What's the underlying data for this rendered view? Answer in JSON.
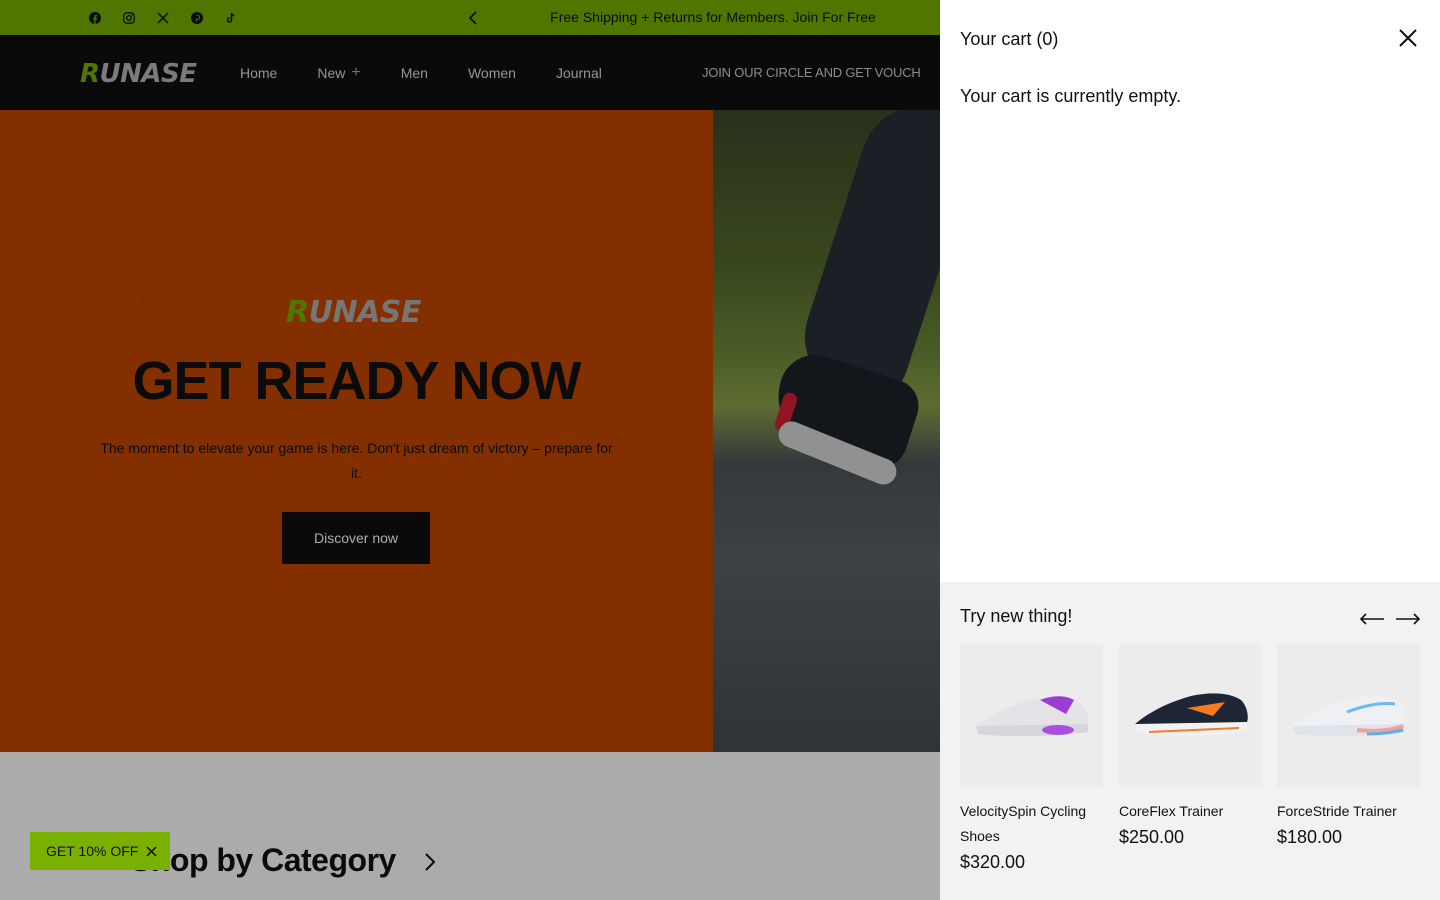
{
  "announcement": {
    "text": "Free Shipping + Returns for Members. Join For Free",
    "social_icons": [
      "facebook-icon",
      "instagram-icon",
      "x-icon",
      "pinterest-icon",
      "tiktok-icon"
    ]
  },
  "header": {
    "logo_text_r": "R",
    "logo_text_rest": "UNASE",
    "nav": [
      {
        "label": "Home"
      },
      {
        "label": "New",
        "icon": "plus-icon"
      },
      {
        "label": "Men"
      },
      {
        "label": "Women"
      },
      {
        "label": "Journal"
      }
    ],
    "marquee": "JOIN OUR CIRCLE AND GET VOUCH"
  },
  "hero": {
    "logo_r": "R",
    "logo_rest": "UNASE",
    "title": "GET READY NOW",
    "subtitle": "The moment to elevate your game is here. Don't just dream of victory – prepare for it.",
    "button": "Discover now"
  },
  "category": {
    "title": "Shop by Category"
  },
  "promo": {
    "label": "GET 10% OFF"
  },
  "cart": {
    "title": "Your cart (0)",
    "empty_message": "Your cart is currently empty.",
    "recommendations": {
      "title": "Try new thing!",
      "products": [
        {
          "name": "VelocitySpin Cycling Shoes",
          "price": "$320.00"
        },
        {
          "name": "CoreFlex Trainer",
          "price": "$250.00"
        },
        {
          "name": "ForceStride Trainer",
          "price": "$180.00"
        }
      ]
    }
  },
  "colors": {
    "accent": "#7ab100",
    "hero_orange": "#c44600",
    "dark": "#101010"
  }
}
